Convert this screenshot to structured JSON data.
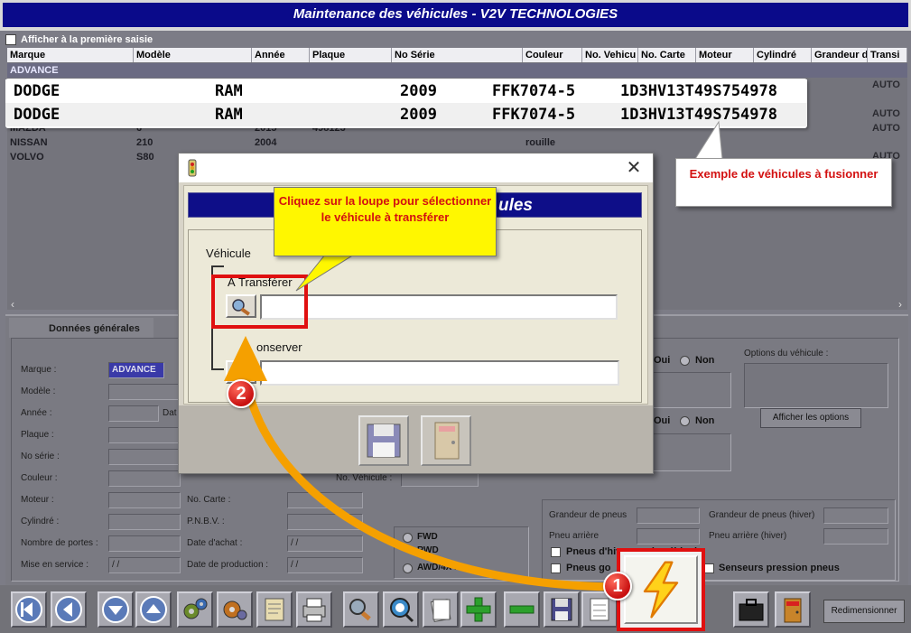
{
  "window": {
    "title": "Maintenance des véhicules - V2V TECHNOLOGIES"
  },
  "first_entry": {
    "label": "Afficher à la première saisie"
  },
  "grid": {
    "columns": [
      "Marque",
      "Modèle",
      "Année",
      "Plaque",
      "No Série",
      "Couleur",
      "No. Vehicu",
      "No. Carte",
      "Moteur",
      "Cylindré",
      "Grandeur d",
      "Transi"
    ],
    "rows": [
      {
        "marque": "ADVANCE",
        "modele": "",
        "annee": "",
        "plaque": "",
        "couleur": ""
      },
      {
        "marque": "MAZDA",
        "modele": "6",
        "annee": "2015",
        "plaque": "498123",
        "couleur": ""
      },
      {
        "marque": "NISSAN",
        "modele": "210",
        "annee": "2004",
        "plaque": "",
        "couleur": "rouille"
      },
      {
        "marque": "VOLVO",
        "modele": "S80",
        "annee": "",
        "plaque": "",
        "couleur": ""
      }
    ],
    "transmission_values": [
      "AUTO",
      "AUTO",
      "AUTO",
      "AUTO"
    ],
    "duplicate_rows": [
      {
        "marque": "DODGE",
        "modele": "RAM",
        "annee": "2009",
        "plaque": "FFK7074-5",
        "serie": "1D3HV13T49S754978"
      },
      {
        "marque": "DODGE",
        "modele": "RAM",
        "annee": "2009",
        "plaque": "FFK7074-5",
        "serie": "1D3HV13T49S754978"
      }
    ]
  },
  "form": {
    "tab_general": "Données générales",
    "labels": {
      "marque": "Marque :",
      "modele": "Modèle :",
      "annee": "Année :",
      "plaque": "Plaque :",
      "no_serie": "No série :",
      "couleur": "Couleur :",
      "moteur": "Moteur :",
      "cylindre": "Cylindré :",
      "portes": "Nombre de portes :",
      "mise_service": "Mise en service :",
      "no_carte": "No. Carte :",
      "pnbv": "P.N.B.V. :",
      "date_achat": "Date d'achat :",
      "date_production": "Date de production :",
      "no_vehicule": "No. Véhicule :",
      "dat": "Dat"
    },
    "values": {
      "marque": "ADVANCE",
      "date_achat": " / /",
      "mise_service": " / /",
      "date_production": " / /"
    },
    "oui": "Oui",
    "non": "Non",
    "options_label": "Options du véhicule :",
    "afficher_options": "Afficher les options",
    "traction": [
      "FWD",
      "RWD",
      "AWD/4X4"
    ],
    "tires": {
      "grandeur": "Grandeur de pneus",
      "grandeur_hiver": "Grandeur de pneus (hiver)",
      "arriere": "Pneu arrière",
      "arriere_hiver": "Pneu arrière (hiver)",
      "pneus_hiver": "Pneus d'hiver sur le véhicule",
      "pneus_go": "Pneus go",
      "senseurs": "Senseurs pression pneus",
      "sur_vehicule": "sur le véhicule"
    }
  },
  "toolbar": {
    "resize": "Redimensionner"
  },
  "dialog": {
    "banner": "ules",
    "group_label": "Véhicule",
    "transfer_label": "À Transférer",
    "conserve_label": "onserver",
    "transfer_value": "",
    "conserve_value": ""
  },
  "tutorial": {
    "yellow_callout": "Cliquez sur la loupe pour sélectionner le véhicule à transférer",
    "white_callout": "Exemple de véhicules à fusionner",
    "step1": "1",
    "step2": "2"
  },
  "colors": {
    "title_bar": "#0a0a8a",
    "callout_text": "#d31010",
    "highlight": "#e01010",
    "arrow": "#f5a000"
  }
}
